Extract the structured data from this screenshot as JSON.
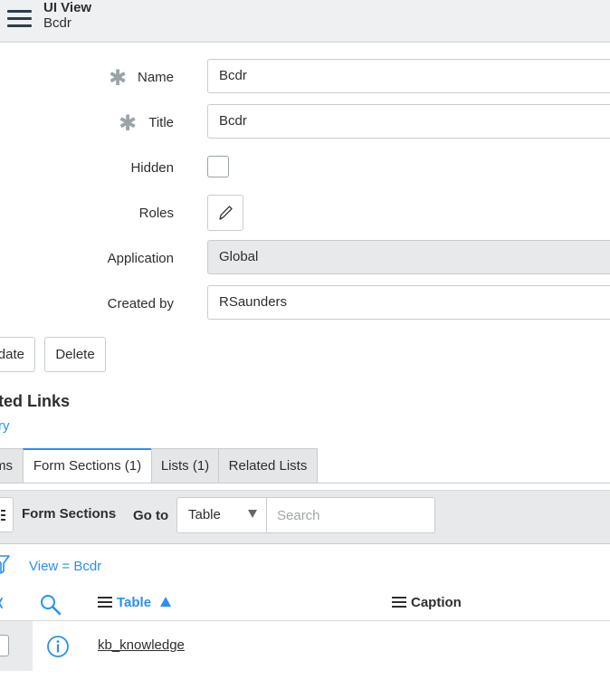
{
  "header": {
    "title": "UI View",
    "subtitle": "Bcdr"
  },
  "form": {
    "name": {
      "label": "Name",
      "value": "Bcdr",
      "required": true
    },
    "title": {
      "label": "Title",
      "value": "Bcdr",
      "required": true
    },
    "hidden": {
      "label": "Hidden",
      "checked": false
    },
    "roles": {
      "label": "Roles"
    },
    "application": {
      "label": "Application",
      "value": "Global"
    },
    "created_by": {
      "label": "Created by",
      "value": "RSaunders"
    }
  },
  "buttons": {
    "update": "date",
    "delete": "Delete"
  },
  "related_links": {
    "title": "ted Links",
    "link": "ry"
  },
  "tabs": [
    {
      "label": "ms",
      "active": false
    },
    {
      "label": "Form Sections (1)",
      "active": true
    },
    {
      "label": "Lists (1)",
      "active": false
    },
    {
      "label": "Related Lists",
      "active": false
    }
  ],
  "list": {
    "title": "Form Sections",
    "goto_label": "Go to",
    "goto_select": "Table",
    "search_placeholder": "Search",
    "filter_breadcrumb": "View = Bcdr",
    "columns": {
      "table": "Table",
      "caption": "Caption"
    },
    "rows": [
      {
        "table": "kb_knowledge",
        "caption": ""
      }
    ]
  },
  "colors": {
    "accent": "#278efc",
    "header_bg": "#eef0f1",
    "readonly_bg": "#e7e9eb"
  }
}
